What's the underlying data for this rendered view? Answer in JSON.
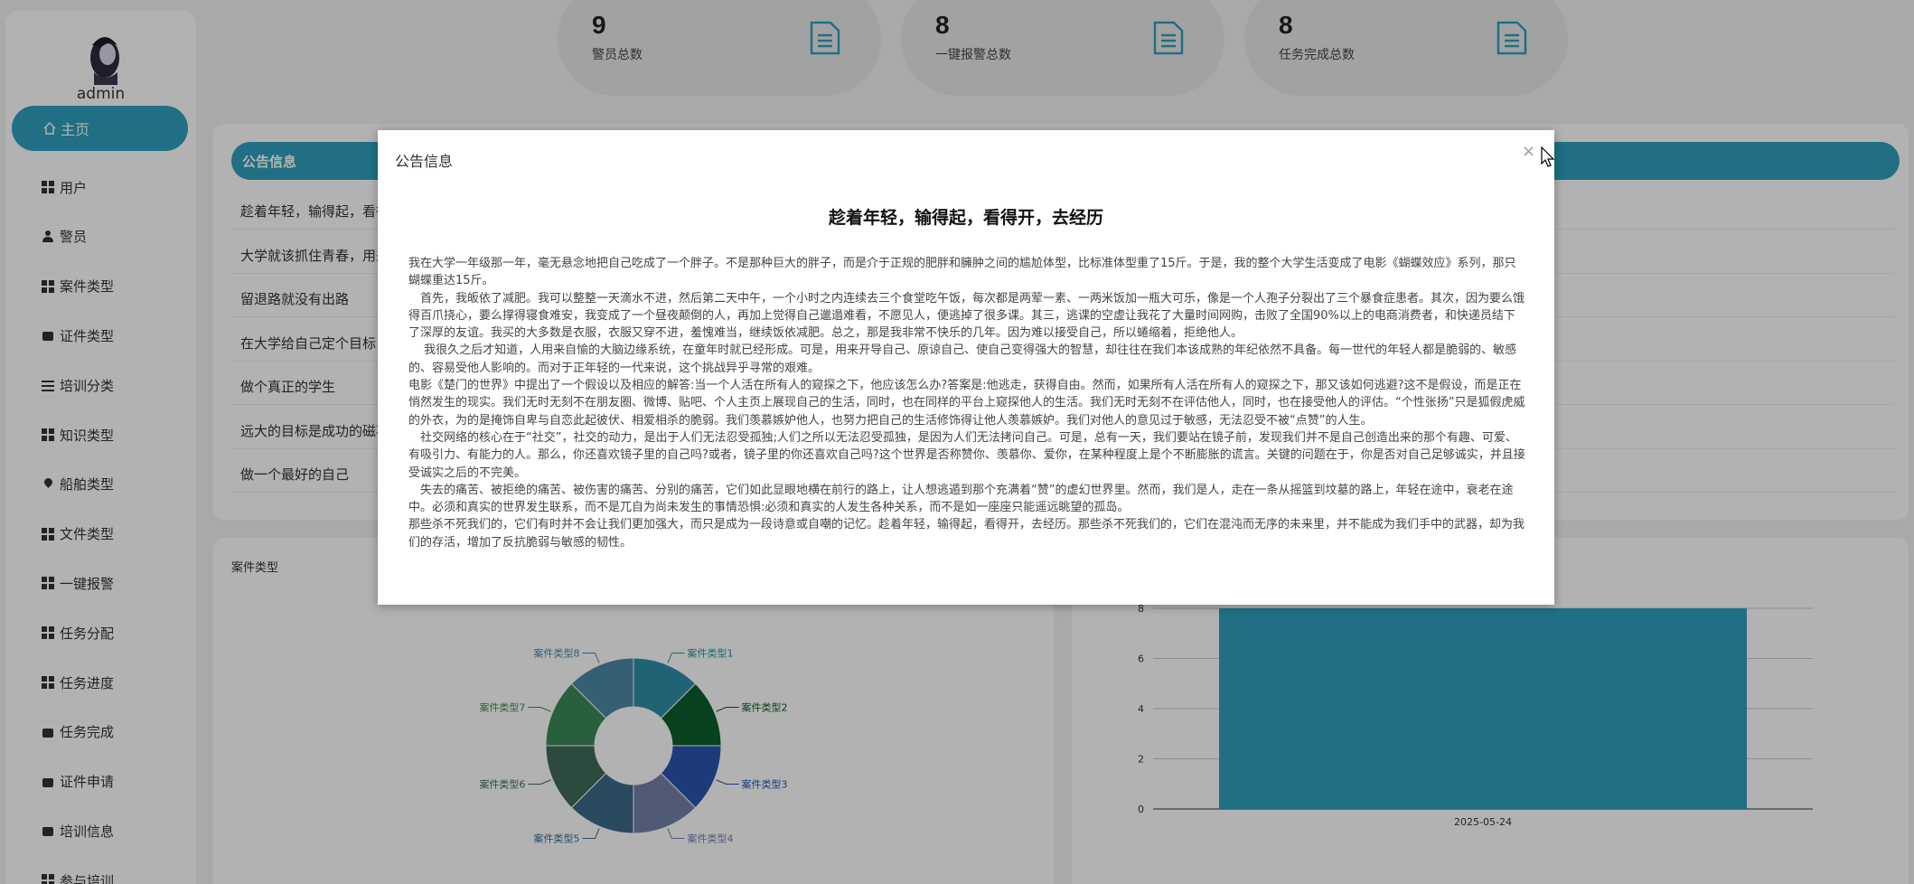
{
  "sidebar": {
    "username": "admin",
    "home_label": "主页",
    "items": [
      {
        "label": "用户",
        "icon": "grid-icon"
      },
      {
        "label": "警员",
        "icon": "user-icon"
      },
      {
        "label": "案件类型",
        "icon": "grid-icon"
      },
      {
        "label": "证件类型",
        "icon": "box-icon"
      },
      {
        "label": "培训分类",
        "icon": "slider-icon"
      },
      {
        "label": "知识类型",
        "icon": "grid-icon"
      },
      {
        "label": "船舶类型",
        "icon": "pin-icon"
      },
      {
        "label": "文件类型",
        "icon": "grid-icon"
      },
      {
        "label": "一键报警",
        "icon": "grid-icon"
      },
      {
        "label": "任务分配",
        "icon": "grid-icon"
      },
      {
        "label": "任务进度",
        "icon": "grid-icon"
      },
      {
        "label": "任务完成",
        "icon": "box-icon"
      },
      {
        "label": "证件申请",
        "icon": "box-icon"
      },
      {
        "label": "培训信息",
        "icon": "box-icon"
      },
      {
        "label": "参与培训",
        "icon": "grid-icon"
      }
    ]
  },
  "stats": [
    {
      "value": "9",
      "label": "警员总数",
      "icon": "document-icon"
    },
    {
      "value": "8",
      "label": "一键报警总数",
      "icon": "document-icon"
    },
    {
      "value": "8",
      "label": "任务完成总数",
      "icon": "document-icon"
    }
  ],
  "notice": {
    "header": "公告信息",
    "rows": [
      "趁着年轻，输得起，看得开，去经历",
      "大学就该抓住青春，用来",
      "留退路就没有出路",
      "在大学给自己定个目标",
      "做个真正的学生",
      "远大的目标是成功的磁石",
      "做一个最好的自己"
    ]
  },
  "modal": {
    "title": "公告信息",
    "close": "×",
    "article_title": "趁着年轻，输得起，看得开，去经历",
    "paragraphs": [
      "我在大学一年级那一年，毫无悬念地把自己吃成了一个胖子。不是那种巨大的胖子，而是介于正规的肥胖和臃肿之间的尴尬体型，比标准体型重了15斤。于是，我的整个大学生活变成了电影《蝴蝶效应》系列，那只蝴蝶重达15斤。",
      "　首先，我皈依了减肥。我可以整整一天滴水不进，然后第二天中午，一个小时之内连续去三个食堂吃午饭，每次都是两荤一素、一两米饭加一瓶大可乐，像是一个人孢子分裂出了三个暴食症患者。其次，因为要么饿得百爪挠心，要么撑得寝食难安，我变成了一个昼夜颠倒的人，再加上觉得自己邋遢难看，不愿见人，便逃掉了很多课。其三，逃课的空虚让我花了大量时间网购，击败了全国90%以上的电商消费者，和快递员结下了深厚的友谊。我买的大多数是衣服，衣服又穿不进，羞愧难当，继续饭依减肥。总之，那是我非常不快乐的几年。因为难以接受自己，所以蜷缩着，拒绝他人。",
      "　 我很久之后才知道，人用来自愉的大脑边缘系统，在童年时就已经形成。可是，用来开导自己、原谅自己、使自己变得强大的智慧，却往往在我们本该成熟的年纪依然不具备。每一世代的年轻人都是脆弱的、敏感的、容易受他人影响的。而对于正年轻的一代来说，这个挑战异乎寻常的艰难。",
      " 电影《楚门的世界》中提出了一个假设以及相应的解答:当一个人活在所有人的窥探之下，他应该怎么办?答案是:他逃走，获得自由。然而，如果所有人活在所有人的窥探之下，那又该如何逃避?这不是假设，而是正在悄然发生的现实。我们无时无刻不在朋友圈、微博、贴吧、个人主页上展现自己的生活，同时，也在同样的平台上窥探他人的生活。我们无时无刻不在评估他人，同时，也在接受他人的评估。“个性张扬”只是狐假虎威的外衣，为的是掩饰自卑与自恋此起彼伏、相爱相杀的脆弱。我们羡慕嫉妒他人，也努力把自己的生活修饰得让他人羡慕嫉妒。我们对他人的意见过于敏感，无法忍受不被“点赞”的人生。",
      "　社交网络的核心在于“社交”，社交的动力，是出于人们无法忍受孤独;人们之所以无法忍受孤独，是因为人们无法拷问自己。可是，总有一天，我们要站在镜子前，发现我们并不是自己创造出来的那个有趣、可爱、有吸引力、有能力的人。那么，你还喜欢镜子里的自己吗?或者，镜子里的你还喜欢自己吗?这个世界是否称赞你、羡慕你、爱你，在某种程度上是个不断膨胀的谎言。关键的问题在于，你是否对自己足够诚实，并且接受诚实之后的不完美。",
      "　失去的痛苦、被拒绝的痛苦、被伤害的痛苦、分别的痛苦，它们如此显眼地横在前行的路上，让人想逃遁到那个充满着“赞”的虚幻世界里。然而，我们是人，走在一条从摇篮到坟墓的路上，年轻在途中，衰老在途中。必须和真实的世界发生联系，而不是兀自为尚未发生的事情恐惧:必须和真实的人发生各种关系，而不是如一座座只能遥远眺望的孤岛。",
      "那些杀不死我们的，它们有时并不会让我们更加强大，而只是成为一段诗意或自嘲的记忆。趁着年轻，输得起，看得开，去经历。那些杀不死我们的，它们在混沌而无序的未来里，并不能成为我们手中的武器，却为我们的存活，增加了反抗脆弱与敏感的韧性。"
    ]
  },
  "chart_data": [
    {
      "type": "pie",
      "title": "案件类型",
      "categories": [
        "案件类型1",
        "案件类型2",
        "案件类型3",
        "案件类型4",
        "案件类型5",
        "案件类型6",
        "案件类型7",
        "案件类型8"
      ],
      "values": [
        1,
        1,
        1,
        1,
        1,
        1,
        1,
        1
      ],
      "colors": [
        "#2e8fa8",
        "#0b5e2b",
        "#2a54b0",
        "#7482a8",
        "#3d6b8a",
        "#3f6a58",
        "#3a8a5a",
        "#4d88a6"
      ],
      "donut": true
    },
    {
      "type": "bar",
      "categories": [
        "2025-05-24"
      ],
      "values": [
        8
      ],
      "ylim": [
        0,
        8
      ],
      "yticks": [
        "0",
        "2",
        "4",
        "6",
        "8"
      ],
      "color": "#2e9fbf",
      "grid": true
    }
  ]
}
